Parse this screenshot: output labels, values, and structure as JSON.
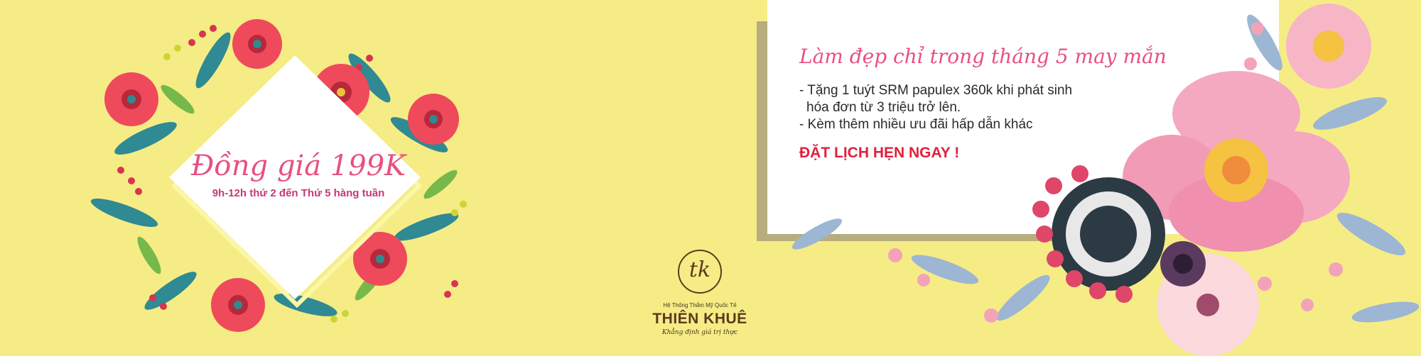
{
  "promo": {
    "title": "Đồng giá 199K",
    "subtitle": "9h-12h thứ 2 đến Thứ 5 hàng tuần"
  },
  "card": {
    "title": "Làm đẹp chỉ trong tháng 5 may mắn",
    "bullet1_line1": "- Tặng 1 tuýt SRM papulex 360k khi phát sinh",
    "bullet1_line2": "hóa đơn từ 3 triệu trở lên.",
    "bullet2": "- Kèm thêm nhiều ưu đãi hấp dẫn khác",
    "cta": "ĐẶT LỊCH HẸN NGAY !"
  },
  "logo": {
    "mark": "tk",
    "subtitle": "Hệ Thống Thẩm Mỹ Quốc Tế",
    "name": "THIÊN KHUÊ",
    "slogan": "Khẳng định giá trị thực"
  },
  "colors": {
    "background": "#f6ec85",
    "accent_pink": "#e8507f",
    "cta_red": "#e0203c",
    "brand_brown": "#5b3a1f"
  }
}
